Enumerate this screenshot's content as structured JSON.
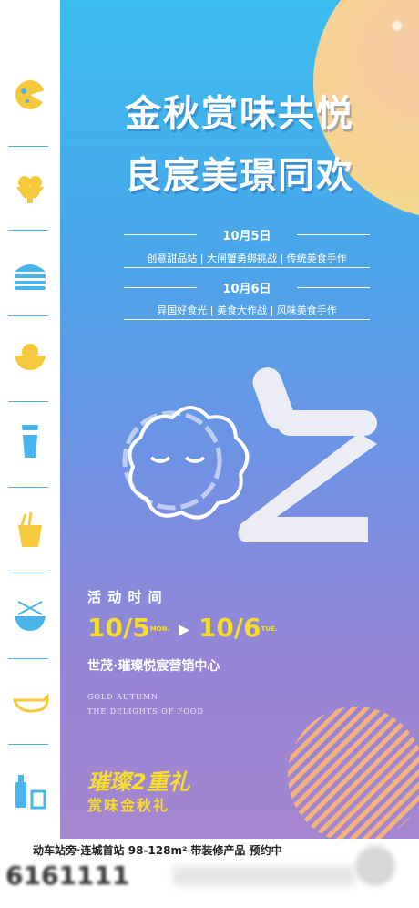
{
  "title_line1": "金秋赏味共悦",
  "title_line2": "良宸美璟同欢",
  "day1": {
    "date": "10月5日",
    "events": "创意甜品站 | 大闸蟹勇绑挑战 | 传统美食手作"
  },
  "day2": {
    "date": "10月6日",
    "events": "异国好食光  |  美食大作战  |  风味美食手作"
  },
  "activity_label": "活 动 时 间",
  "activity_date_start": "10/5",
  "activity_date_end": "10/6",
  "activity_day_start": "MON.",
  "activity_day_end": "TUE.",
  "venue": "世茂·璀璨悦宸营销中心",
  "english_line1": "GOLD AUTUMN",
  "english_line2": "THE DELIGHTS OF FOOD",
  "bottom_logo": "璀璨2重礼",
  "bottom_subtitle": "赏味金秋礼",
  "footer_line": "动车站旁·连城首站 98-128m² 带装修产品 预约中",
  "footer_phone": "6161111",
  "colors": {
    "accent_yellow": "#f6dd2b",
    "icon_blue": "#4bb4ea",
    "icon_yellow": "#f6c93c"
  },
  "sidebar_icons": [
    "cheese-icon",
    "ice-cream-icon",
    "burger-icon",
    "rice-bowl-icon",
    "drink-cup-icon",
    "noodle-box-icon",
    "noodle-bowl-icon",
    "gravy-boat-icon",
    "bottles-icon"
  ]
}
